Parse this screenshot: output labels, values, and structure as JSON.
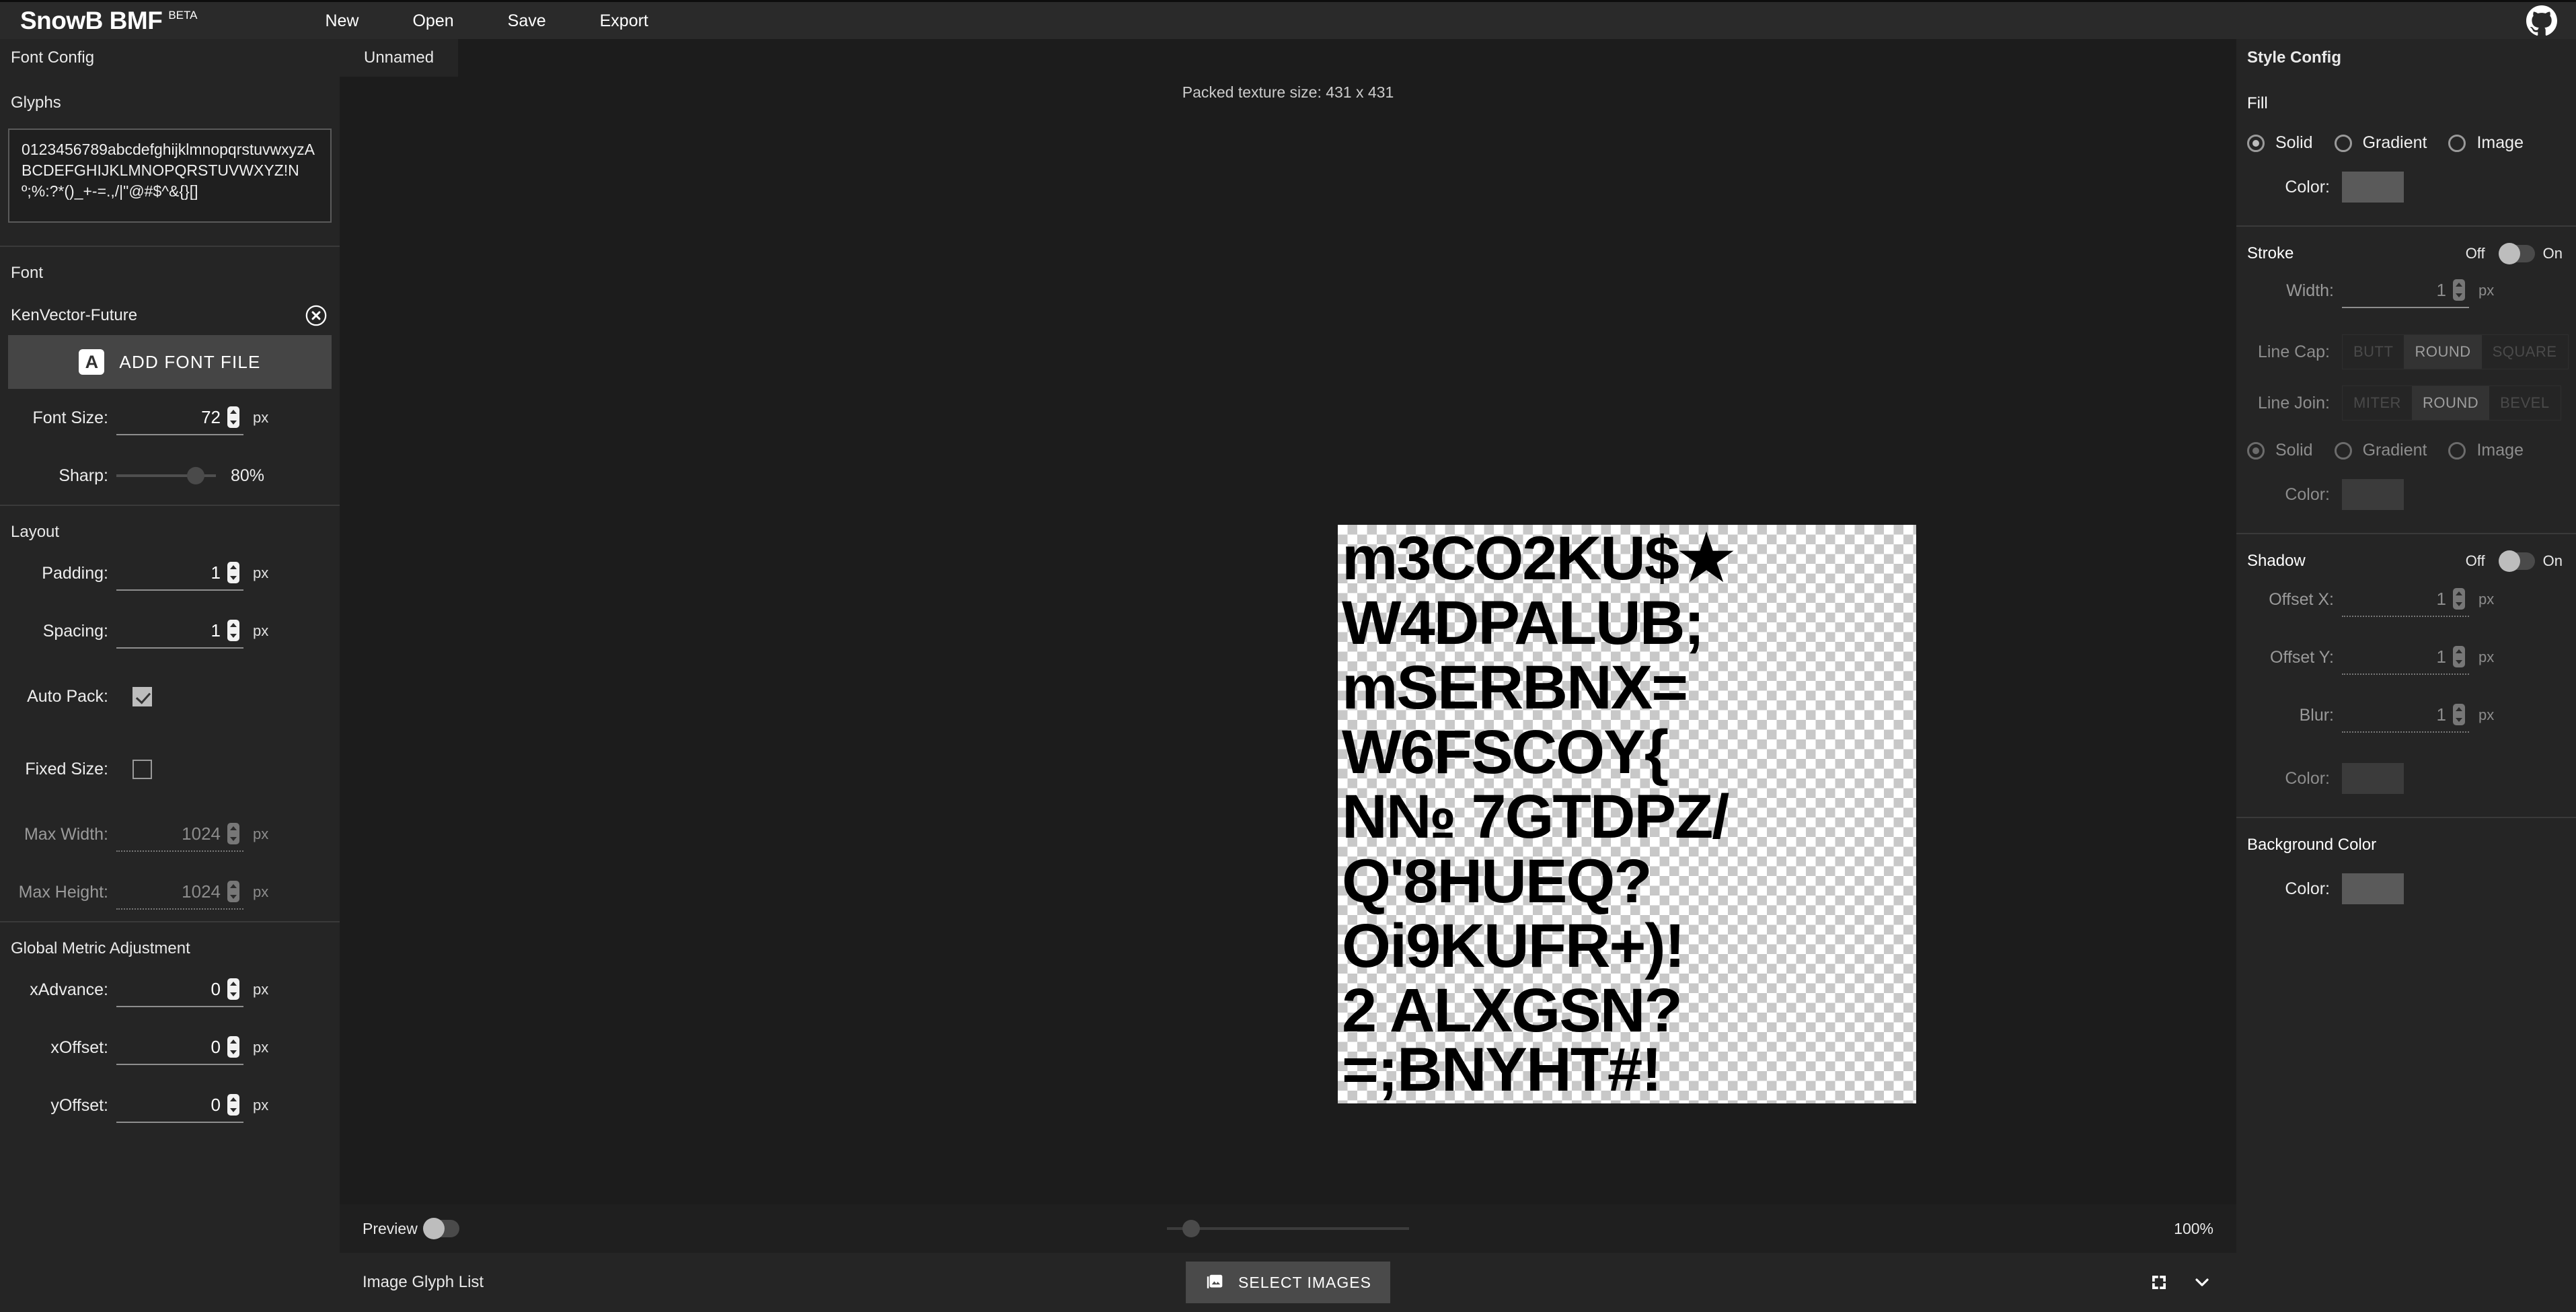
{
  "app": {
    "brand": "SnowB BMF",
    "beta": "BETA",
    "nav": [
      {
        "label": "New"
      },
      {
        "label": "Open"
      },
      {
        "label": "Save"
      },
      {
        "label": "Export"
      }
    ],
    "github_icon": "github-icon"
  },
  "subbar": {
    "left_title": "Font Config",
    "tab": "Unnamed",
    "right_title": "Style Config"
  },
  "font_config": {
    "glyphs": {
      "title": "Glyphs",
      "value": "0123456789abcdefghijklmnopqrstuvwxyzABCDEFGHIJKLMNOPQRSTUVWXYZ!Nº;%:?*()_+-=.,/|\"@#$^&{}[]"
    },
    "font": {
      "title": "Font",
      "name": "KenVector-Future",
      "clear_icon": "clear-circle-icon",
      "add_button": "ADD FONT FILE",
      "add_button_icon": "font-file-icon",
      "size": {
        "label": "Font Size:",
        "value": "72",
        "unit": "px"
      },
      "sharp": {
        "label": "Sharp:",
        "value": "80%",
        "percent": 80
      }
    },
    "layout": {
      "title": "Layout",
      "padding": {
        "label": "Padding:",
        "value": "1",
        "unit": "px"
      },
      "spacing": {
        "label": "Spacing:",
        "value": "1",
        "unit": "px"
      },
      "auto_pack": {
        "label": "Auto Pack:",
        "checked": true
      },
      "fixed_size": {
        "label": "Fixed Size:",
        "checked": false
      },
      "max_width": {
        "label": "Max Width:",
        "value": "1024",
        "unit": "px",
        "disabled": true
      },
      "max_height": {
        "label": "Max Height:",
        "value": "1024",
        "unit": "px",
        "disabled": true
      }
    },
    "metrics": {
      "title": "Global Metric Adjustment",
      "x_advance": {
        "label": "xAdvance:",
        "value": "0",
        "unit": "px"
      },
      "x_offset": {
        "label": "xOffset:",
        "value": "0",
        "unit": "px"
      },
      "y_offset": {
        "label": "yOffset:",
        "value": "0",
        "unit": "px"
      }
    }
  },
  "canvas": {
    "packed_info": "Packed texture size: 431 x 431",
    "atlas_rows": [
      "m3CO2KU$★",
      "W4DPALUB;",
      "mSERBNX=",
      "W6FSCOY{",
      "N№ 7GTDPZ/",
      "Q'8HUEQ?",
      "Oi9KUFR+)!",
      "2 ALXGSN?",
      "=;BNYHT#!"
    ]
  },
  "preview_bar": {
    "label": "Preview",
    "toggle_on": false,
    "zoom_percent": "100%",
    "zoom_slider_value": 10
  },
  "image_glyph_bar": {
    "label": "Image Glyph List",
    "select_images": "SELECT IMAGES",
    "select_images_icon": "images-icon",
    "fullscreen_icon": "fullscreen-icon",
    "collapse_icon": "chevron-down-icon"
  },
  "style_config": {
    "fill": {
      "title": "Fill",
      "modes": [
        {
          "label": "Solid",
          "selected": true
        },
        {
          "label": "Gradient",
          "selected": false
        },
        {
          "label": "Image",
          "selected": false
        }
      ],
      "color": {
        "label": "Color:",
        "value": "#000000"
      }
    },
    "stroke": {
      "title": "Stroke",
      "toggle": {
        "off": "Off",
        "on": "On",
        "enabled": false
      },
      "width": {
        "label": "Width:",
        "value": "1",
        "unit": "px"
      },
      "line_cap": {
        "label": "Line Cap:",
        "options": [
          "BUTT",
          "ROUND",
          "SQUARE"
        ],
        "selected": "ROUND"
      },
      "line_join": {
        "label": "Line Join:",
        "options": [
          "MITER",
          "ROUND",
          "BEVEL"
        ],
        "selected": "ROUND"
      },
      "modes": [
        {
          "label": "Solid",
          "selected": true
        },
        {
          "label": "Gradient",
          "selected": false
        },
        {
          "label": "Image",
          "selected": false
        }
      ],
      "color": {
        "label": "Color:",
        "value": "#1a1a1a"
      }
    },
    "shadow": {
      "title": "Shadow",
      "toggle": {
        "off": "Off",
        "on": "On",
        "enabled": false
      },
      "offset_x": {
        "label": "Offset X:",
        "value": "1",
        "unit": "px"
      },
      "offset_y": {
        "label": "Offset Y:",
        "value": "1",
        "unit": "px"
      },
      "blur": {
        "label": "Blur:",
        "value": "1",
        "unit": "px"
      },
      "color": {
        "label": "Color:",
        "value": "#1a1a1a"
      }
    },
    "background": {
      "title": "Background Color",
      "color": {
        "label": "Color:",
        "value": "transparent"
      }
    }
  }
}
